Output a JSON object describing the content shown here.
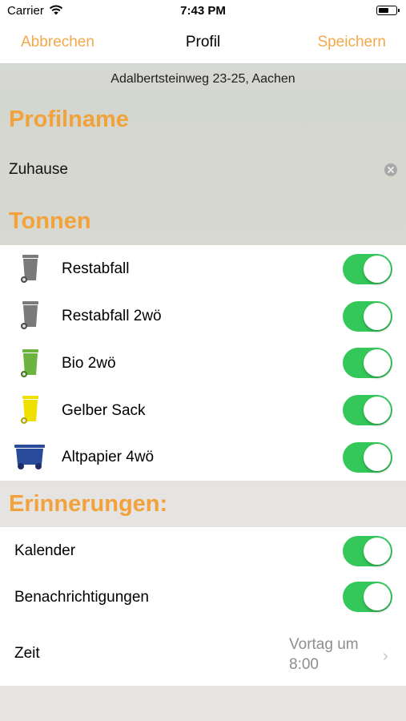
{
  "status_bar": {
    "carrier": "Carrier",
    "time": "7:43 PM"
  },
  "nav": {
    "cancel_label": "Abbrechen",
    "title": "Profil",
    "save_label": "Speichern"
  },
  "address": "Adalbertsteinweg 23-25, Aachen",
  "profile_section": {
    "header": "Profilname",
    "name_value": "Zuhause"
  },
  "bins_section": {
    "header": "Tonnen",
    "items": [
      {
        "label": "Restabfall",
        "icon": "gray-bin-icon",
        "color": "#7a7a7a",
        "enabled": true
      },
      {
        "label": "Restabfall 2wö",
        "icon": "gray-bin-icon",
        "color": "#7a7a7a",
        "enabled": true
      },
      {
        "label": "Bio 2wö",
        "icon": "green-bin-icon",
        "color": "#6db33f",
        "enabled": true
      },
      {
        "label": "Gelber Sack",
        "icon": "yellow-bin-icon",
        "color": "#f0e000",
        "enabled": true
      },
      {
        "label": "Altpapier 4wö",
        "icon": "blue-container-icon",
        "color": "#2a4a9a",
        "enabled": true
      }
    ]
  },
  "reminders_section": {
    "header": "Erinnerungen:",
    "calendar_label": "Kalender",
    "calendar_enabled": true,
    "notifications_label": "Benachrichtigungen",
    "notifications_enabled": true,
    "time_label": "Zeit",
    "time_value_line1": "Vortag um",
    "time_value_line2": "8:00"
  },
  "colors": {
    "accent": "#f2a23a",
    "toggle_on": "#34c759"
  }
}
